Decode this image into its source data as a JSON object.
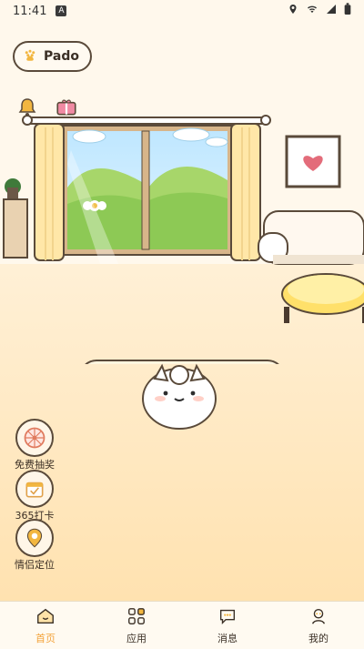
{
  "status_bar": {
    "time": "11:41",
    "small_badge": "A"
  },
  "room": {
    "profile_name": "Pado"
  },
  "side_actions": [
    {
      "label": "免费抽奖"
    },
    {
      "label": "365打卡"
    },
    {
      "label": "情侣定位"
    }
  ],
  "tabbar": {
    "items": [
      {
        "label": "首页"
      },
      {
        "label": "应用"
      },
      {
        "label": "消息"
      },
      {
        "label": "我的"
      }
    ],
    "active_index": 0,
    "colors": {
      "accent": "#f3a33b",
      "text": "#3a2f25"
    }
  },
  "icons": {
    "status": [
      "location-icon",
      "wifi-icon",
      "cell-signal-icon",
      "battery-icon"
    ],
    "top_left": [
      "bell-icon",
      "gift-icon"
    ],
    "pill": "paw-icon"
  }
}
